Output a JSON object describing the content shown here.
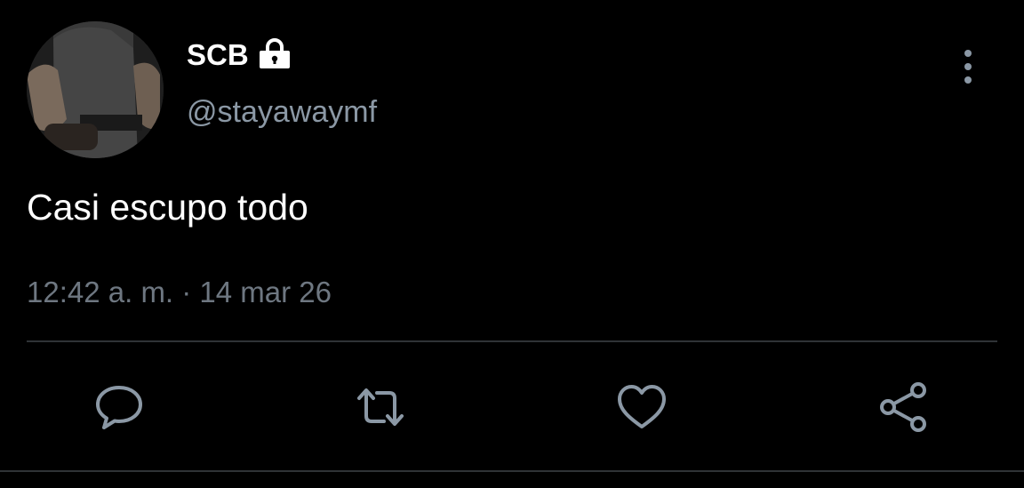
{
  "tweet": {
    "author": {
      "display_name": "SCB",
      "handle": "@stayawaymf",
      "protected_icon": "lock-icon",
      "avatar": "profile-photo"
    },
    "text": "Casi escupo todo",
    "timestamp": "12:42 a. m. · 14 mar 26",
    "menu_icon": "more-vertical-icon"
  },
  "actions": [
    {
      "name": "reply",
      "icon": "comment-icon"
    },
    {
      "name": "retweet",
      "icon": "retweet-icon"
    },
    {
      "name": "like",
      "icon": "heart-icon"
    },
    {
      "name": "share",
      "icon": "share-icon"
    }
  ],
  "colors": {
    "background": "#000000",
    "primary_text": "#ffffff",
    "secondary_text": "#8b98a5",
    "timestamp_text": "#6e7781",
    "divider": "#2f3336"
  }
}
